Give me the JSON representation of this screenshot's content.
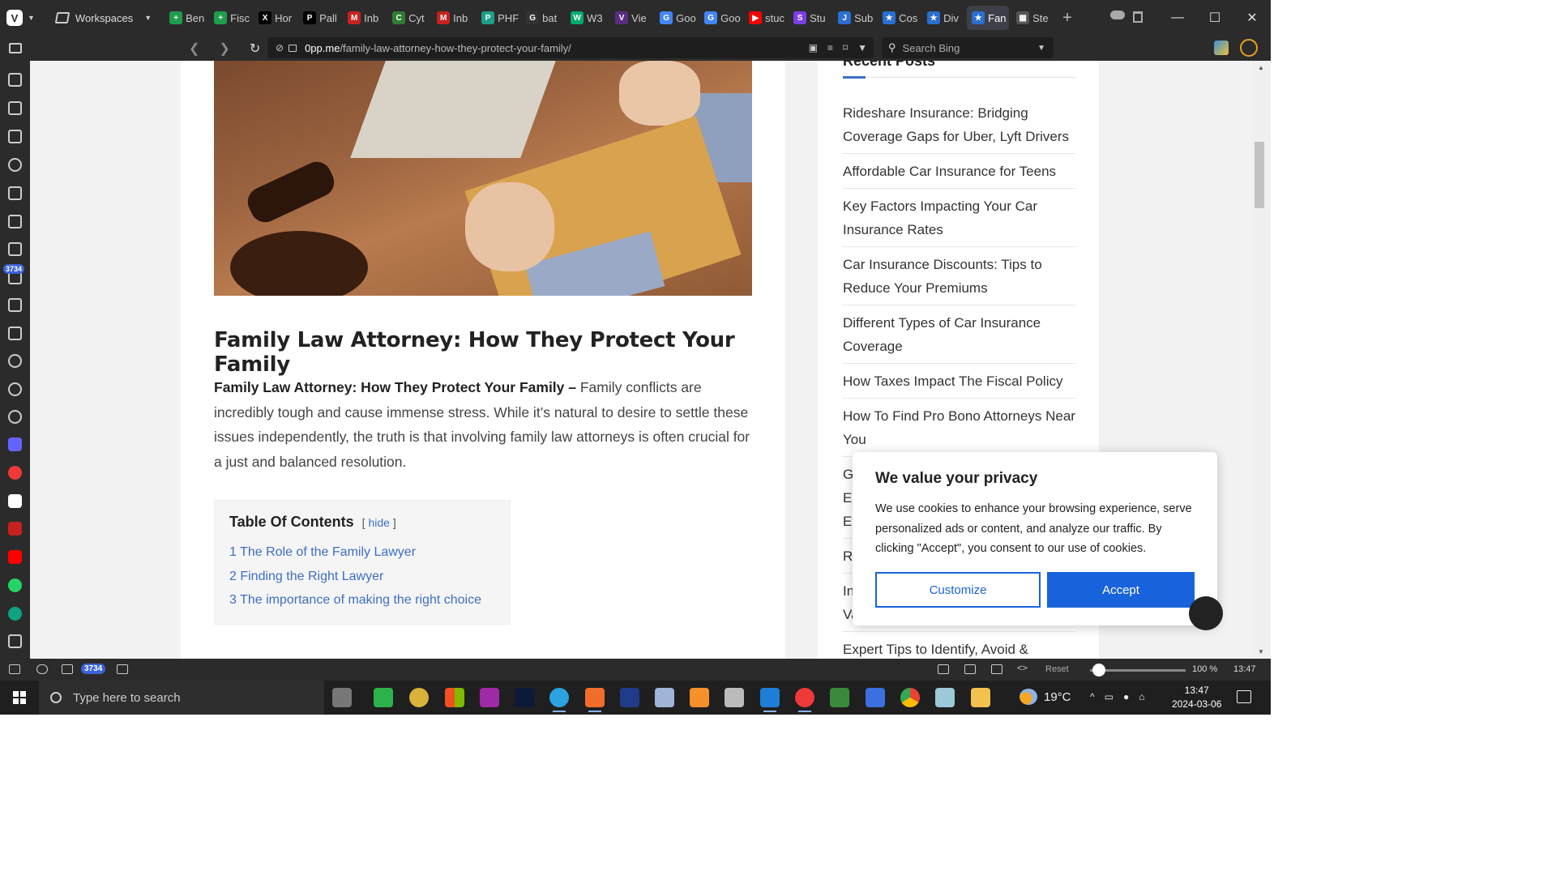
{
  "browser": {
    "workspaces_label": "Workspaces",
    "tabs": [
      {
        "label": "Ben",
        "color": "#1e9e4a",
        "glyph": "+"
      },
      {
        "label": "Fisc",
        "color": "#1e9e4a",
        "glyph": "+"
      },
      {
        "label": "Hor",
        "color": "#000000",
        "glyph": "X"
      },
      {
        "label": "Pall",
        "color": "#000000",
        "glyph": "P"
      },
      {
        "label": "Inb",
        "color": "#c5221f",
        "glyph": "M"
      },
      {
        "label": "Cyt",
        "color": "#2e7d32",
        "glyph": "C"
      },
      {
        "label": "Inb",
        "color": "#c5221f",
        "glyph": "M"
      },
      {
        "label": "PHF",
        "color": "#1e9e8a",
        "glyph": "P"
      },
      {
        "label": "bat",
        "color": "#333333",
        "glyph": "G"
      },
      {
        "label": "W3",
        "color": "#04aa6d",
        "glyph": "W"
      },
      {
        "label": "Vie",
        "color": "#5a2d82",
        "glyph": "V"
      },
      {
        "label": "Goo",
        "color": "#4285f4",
        "glyph": "G"
      },
      {
        "label": "Goo",
        "color": "#4285f4",
        "glyph": "G"
      },
      {
        "label": "stuc",
        "color": "#ff0000",
        "glyph": "▶"
      },
      {
        "label": "Stu",
        "color": "#7b3fe4",
        "glyph": "S"
      },
      {
        "label": "Sub",
        "color": "#2a6fd1",
        "glyph": "J"
      },
      {
        "label": "Cos",
        "color": "#2a6fd1",
        "glyph": "★"
      },
      {
        "label": "Div",
        "color": "#2a6fd1",
        "glyph": "★"
      },
      {
        "label": "Fan",
        "color": "#2a6fd1",
        "glyph": "★"
      },
      {
        "label": "Ste",
        "color": "#555555",
        "glyph": "▦"
      }
    ],
    "active_tab_index": 18,
    "url_domain": "0pp.me",
    "url_path": "/family-law-attorney-how-they-protect-your-family/",
    "search_placeholder": "Search Bing",
    "side_badge": "3734"
  },
  "article": {
    "title": "Family Law Attorney: How They Protect Your Family",
    "intro_bold": "Family Law Attorney: How They Protect Your Family –",
    "intro_text": " Family conflicts are incredibly tough and cause immense stress. While it’s natural to desire to settle these issues independently, the truth is that involving family law attorneys is often crucial for a just and balanced resolution.",
    "toc": {
      "title": "Table Of Contents",
      "hide_prefix": "[",
      "hide_label": "hide",
      "hide_suffix": "]",
      "items": [
        "1  The Role of the Family Lawyer",
        "2  Finding the Right Lawyer",
        "3  The importance of making the right choice"
      ]
    }
  },
  "sidebar": {
    "recent_title": "Recent Posts",
    "posts": [
      "Rideshare Insurance: Bridging Coverage Gaps for Uber, Lyft Drivers",
      "Affordable Car Insurance for Teens",
      "Key Factors Impacting Your Car Insurance Rates",
      "Car Insurance Discounts: Tips to Reduce Your Premiums",
      "Different Types of Car Insurance Coverage",
      "How Taxes Impact The Fiscal Policy",
      "How To Find Pro Bono Attorneys Near You",
      "G",
      "El",
      "Ef",
      "Re",
      "In",
      "Va",
      "Expert Tips to Identify, Avoid &"
    ]
  },
  "cookie": {
    "title": "We value your privacy",
    "text": "We use cookies to enhance your browsing experience, serve personalized ads or content, and analyze our traffic. By clicking \"Accept\", you consent to our use of cookies.",
    "customize_label": "Customize",
    "accept_label": "Accept"
  },
  "statusbar": {
    "badge": "3734",
    "reset_label": "Reset",
    "zoom": "100 %",
    "zoom_level": 1.0,
    "time": "13:47"
  },
  "taskbar": {
    "search_placeholder": "Type here to search",
    "weather": "19°C",
    "clock_time": "13:47",
    "clock_date": "2024-03-06"
  }
}
